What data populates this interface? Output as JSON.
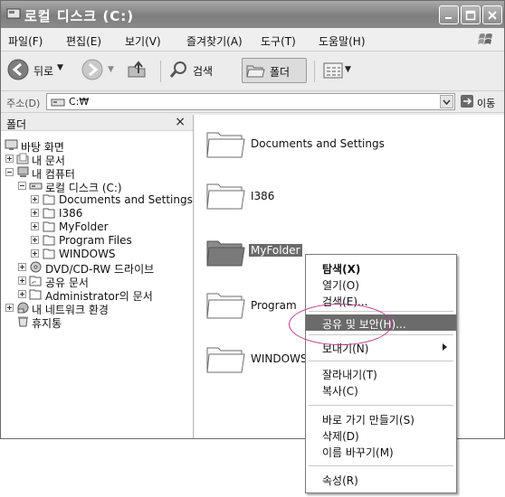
{
  "window": {
    "title": "로컬 디스크 (C:)"
  },
  "menubar": {
    "items": [
      "파일(F)",
      "편집(E)",
      "보기(V)",
      "즐겨찾기(A)",
      "도구(T)",
      "도움말(H)"
    ]
  },
  "toolbar": {
    "back_label": "뒤로",
    "search_label": "검색",
    "folders_label": "폴더"
  },
  "addressbar": {
    "label": "주소(D)",
    "value": "C:₩",
    "go_label": "이동"
  },
  "folder_pane": {
    "title": "폴더",
    "close_glyph": "×",
    "tree": [
      {
        "label": "바탕 화면"
      },
      {
        "label": "내 문서"
      },
      {
        "label": "내 컴퓨터"
      },
      {
        "label": "로컬 디스크 (C:)"
      },
      {
        "label": "Documents and Settings"
      },
      {
        "label": "I386"
      },
      {
        "label": "MyFolder"
      },
      {
        "label": "Program Files"
      },
      {
        "label": "WINDOWS"
      },
      {
        "label": "DVD/CD-RW 드라이브"
      },
      {
        "label": "공유 문서"
      },
      {
        "label": "Administrator의 문서"
      },
      {
        "label": "내 네트워크 환경"
      },
      {
        "label": "휴지통"
      }
    ]
  },
  "content": {
    "folders": [
      {
        "label": "Documents and Settings"
      },
      {
        "label": "I386"
      },
      {
        "label": "MyFolder"
      },
      {
        "label": "Program"
      },
      {
        "label": "WINDOWS"
      }
    ]
  },
  "context_menu": {
    "items": [
      {
        "label": "탐색(X)"
      },
      {
        "label": "열기(O)"
      },
      {
        "label": "검색(E)..."
      },
      {
        "label": "공유 및 보안(H)..."
      },
      {
        "label": "보내기(N)"
      },
      {
        "label": "잘라내기(T)"
      },
      {
        "label": "복사(C)"
      },
      {
        "label": "바로 가기 만들기(S)"
      },
      {
        "label": "삭제(D)"
      },
      {
        "label": "이름 바꾸기(M)"
      },
      {
        "label": "속성(R)"
      }
    ]
  },
  "colors": {
    "highlight": "#6b6b6b",
    "annotation_circle": "#c0398b"
  }
}
